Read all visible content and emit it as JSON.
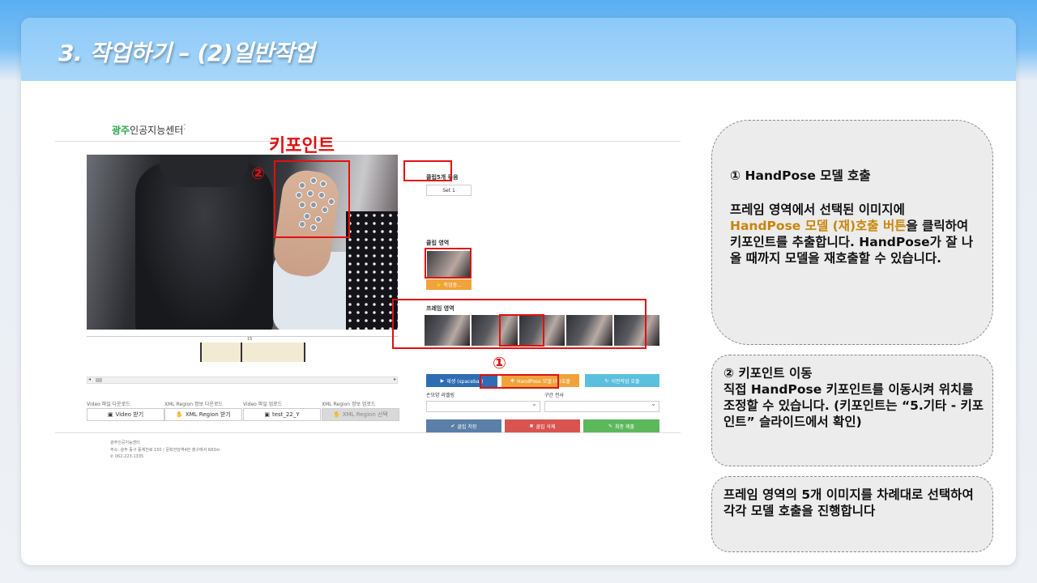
{
  "slide": {
    "title": "3. 작업하기 – (2)일반작업"
  },
  "app": {
    "logo_green": "광주",
    "logo_text": "인공지능센터",
    "clip_group_label": "클립5개 묶음",
    "set_value": "Set 1",
    "clip_area_label": "클립 영역",
    "clip_button": "작업중...",
    "frame_area_label": "프레임 영역",
    "timeline_number": "15",
    "buttons": {
      "play": "재생 (spacebar)",
      "handpose": "HandPose 모델 (재)호출",
      "prev_model": "이전작업 호출",
      "save_clip": "클립 저장",
      "delete_clip": "클립 삭제",
      "final_submit": "최종 제출"
    },
    "hand_label": "손모양 라벨링",
    "section_label": "구간 전사",
    "downloads": [
      {
        "label": "Video 파일 다운로드",
        "button": "Video 받기",
        "icon": "film-icon"
      },
      {
        "label": "XML Region 정보 다운로드",
        "button": "XML Region 받기",
        "icon": "hand-icon"
      },
      {
        "label": "Video 파일 업로드",
        "button": "test_22_Y",
        "icon": "film-icon"
      },
      {
        "label": "XML Region 정보 업로드",
        "button": "XML Region 선택",
        "icon": "hand-icon"
      }
    ],
    "footer": {
      "name": "광주인공지능센터",
      "address": "주소: 광주 동구 동계천로 150 / 문화전당역4번 출구에서 683m",
      "phone": "062-223-1335"
    }
  },
  "annotations": {
    "keypoint_title": "키포인트",
    "marker_1": "①",
    "marker_2": "②"
  },
  "panels": {
    "p1_head": "① HandPose 모델 호출",
    "p1_line_a": "프레임 영역에서 선택된 이미지에",
    "p1_highlight": "HandPose 모델 (재)호출 버튼",
    "p1_line_b": "을 클릭하여 키포인트를 추출합니다. HandPose가 잘 나올 때까지 모델을 재호출할 수 있습니다.",
    "p2_head": "② 키포인트 이동",
    "p2_body": "직접 HandPose 키포인트를 이동시켜 위치를 조정할 수 있습니다. (키포인트는 “5.기타 - 키포인트” 슬라이드에서 확인)",
    "p3_body": "프레임 영역의 5개 이미지를 차례대로 선택하여 각각 모델 호출을 진행합니다"
  },
  "colors": {
    "annotation_red": "#e01010",
    "highlight_gold": "#c8860a",
    "btn_play": "#2e6db4",
    "btn_handpose": "#f0a33b",
    "btn_prev": "#5bc0de",
    "btn_save": "#5a7fa8",
    "btn_delete": "#d9534f",
    "btn_submit": "#5cb85c"
  }
}
